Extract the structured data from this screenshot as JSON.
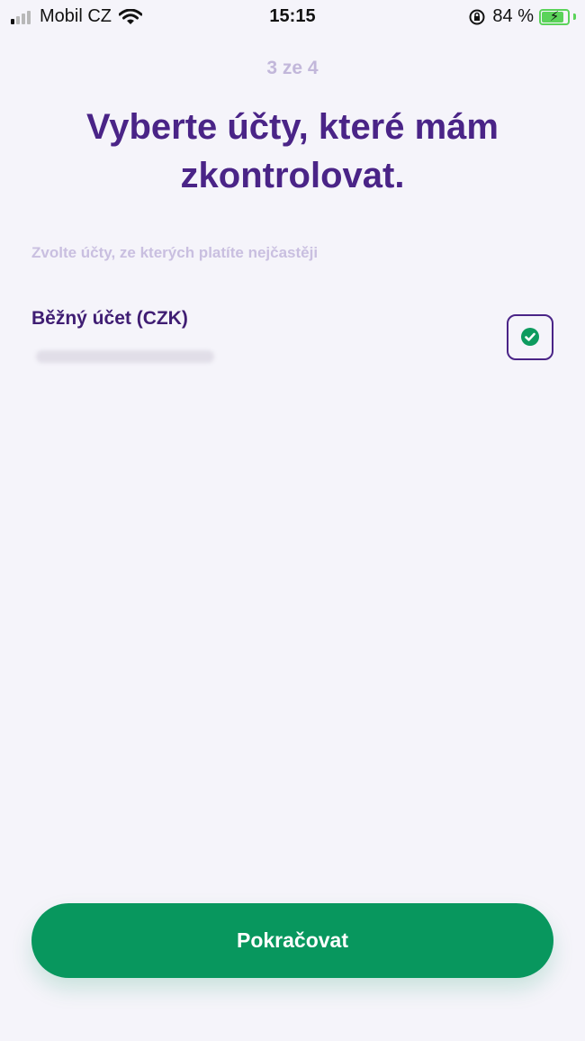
{
  "status_bar": {
    "carrier": "Mobil CZ",
    "time": "15:15",
    "battery_percent": "84 %",
    "battery_color": "#5bd35a",
    "icons": [
      "cellular-signal-icon",
      "wifi-icon",
      "orientation-lock-icon",
      "battery-charging-icon"
    ]
  },
  "step_indicator": "3 ze 4",
  "title": "Vyberte účty, které mám zkontrolovat.",
  "hint": "Zvolte účty, ze kterých platíte nejčastěji",
  "accounts": [
    {
      "name": "Běžný účet (CZK)",
      "selected": true
    }
  ],
  "continue_button": "Pokračovat",
  "colors": {
    "background": "#f5f4fa",
    "primary_purple": "#4a2487",
    "muted_purple": "#c2b7da",
    "accent_green": "#08975e"
  }
}
